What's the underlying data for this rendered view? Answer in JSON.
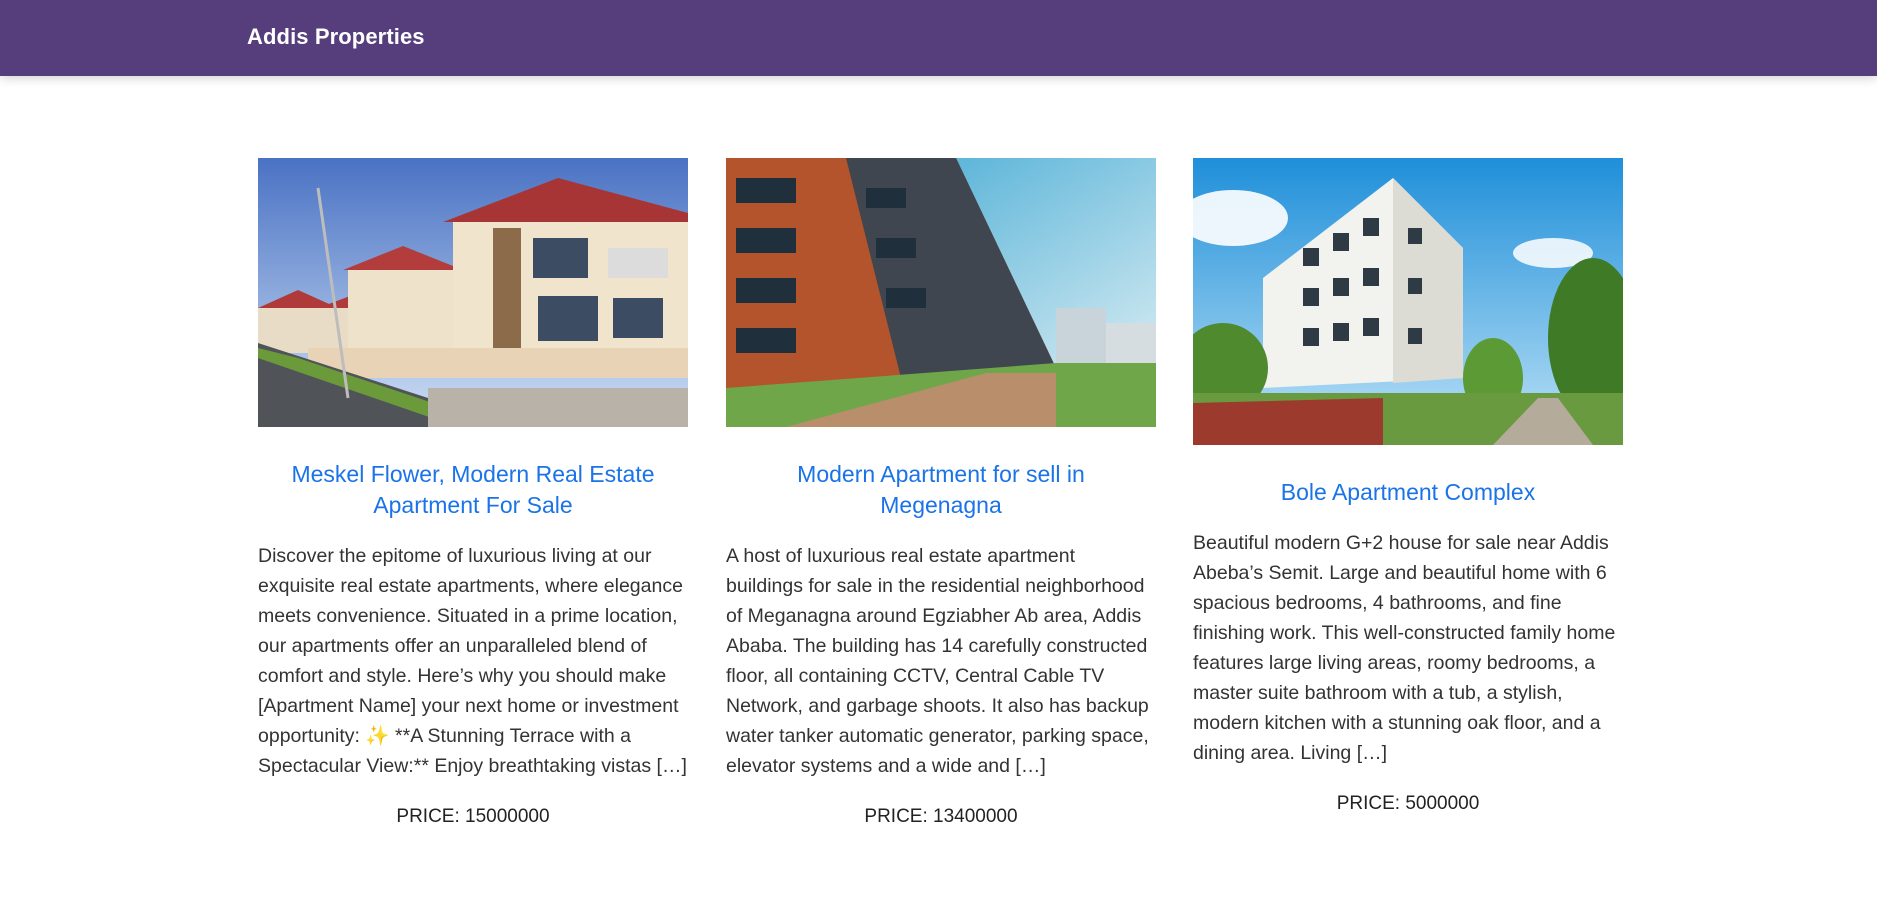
{
  "header": {
    "brand": "Addis Properties",
    "bg_color": "#563d7c"
  },
  "listings": [
    {
      "title": "Meskel Flower, Modern Real Estate Apartment For Sale",
      "excerpt": "Discover the epitome of luxurious living at our exquisite real estate apartments, where elegance meets convenience. Situated in a prime location, our apartments offer an unparalleled blend of comfort and style. Here’s why you should make [Apartment Name] your next home or investment opportunity: ✨ **A Stunning Terrace with a Spectacular View:** Enjoy breathtaking vistas […]",
      "price": "PRICE: 15000000",
      "image_icon": "villa-photo"
    },
    {
      "title": "Modern Apartment for sell in Megenagna",
      "excerpt": "A host of luxurious real estate apartment buildings for sale in the residential neighborhood of Meganagna around Egziabher Ab area, Addis Ababa. The building has 14 carefully constructed floor, all containing CCTV, Central Cable TV Network, and garbage shoots. It also has backup water tanker automatic generator, parking space, elevator systems and a wide and […]",
      "price": "PRICE: 13400000",
      "image_icon": "apartment-block-photo"
    },
    {
      "title": "Bole Apartment Complex",
      "excerpt": "Beautiful modern G+2 house for sale near Addis Abeba’s Semit. Large and beautiful home with 6 spacious bedrooms, 4 bathrooms, and fine finishing work. This well-constructed family home features large living areas, roomy bedrooms, a master suite bathroom with a tub, a stylish, modern kitchen with a stunning oak floor, and a dining area. Living […]",
      "price": "PRICE: 5000000",
      "image_icon": "white-tower-photo"
    }
  ],
  "colors": {
    "link": "#1a73e8",
    "text": "#333333"
  }
}
